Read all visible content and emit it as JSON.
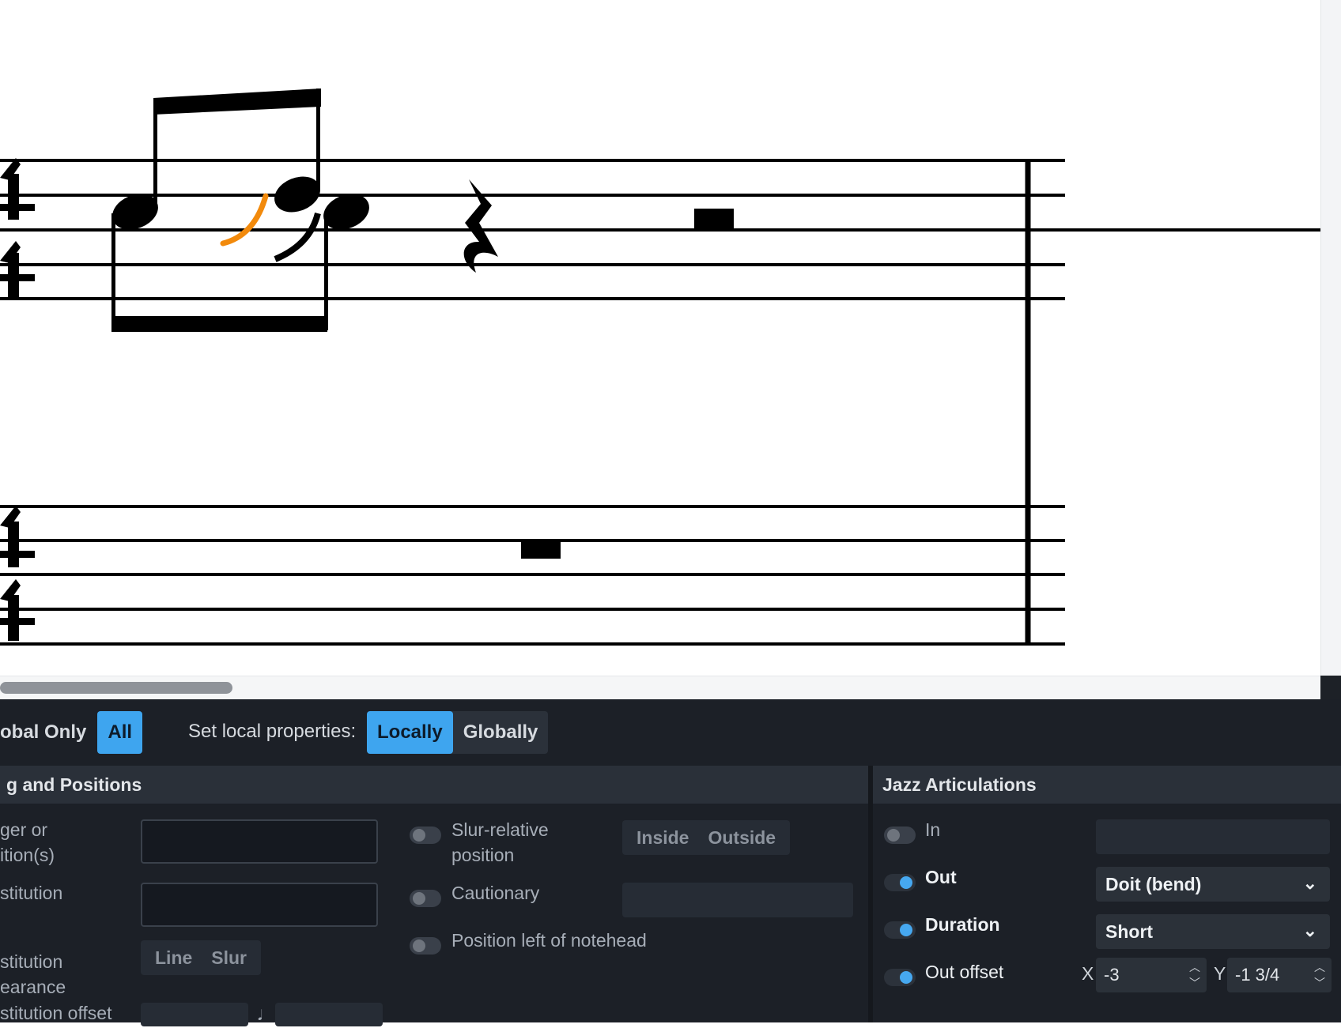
{
  "toolbar": {
    "show_options": [
      "obal Only",
      "All"
    ],
    "set_local_label": "Set local properties:",
    "set_local_options": [
      "Locally",
      "Globally"
    ]
  },
  "left_section": {
    "title": "g and Positions",
    "labels": {
      "finger_line1": "ger or",
      "finger_line2": "ition(s)",
      "substitution": "stitution",
      "appearance_line1": "stitution",
      "appearance_line2": "earance",
      "offset": "stitution offset"
    },
    "appearance_options": [
      "Line",
      "Slur"
    ],
    "slur_relative_line1": "Slur-relative",
    "slur_relative_line2": "position",
    "slur_options": [
      "Inside",
      "Outside"
    ],
    "cautionary": "Cautionary",
    "position_left": "Position left of notehead"
  },
  "right_section": {
    "title": "Jazz Articulations",
    "in_label": "In",
    "out_label": "Out",
    "out_value": "Doit (bend)",
    "duration_label": "Duration",
    "duration_value": "Short",
    "out_offset_label": "Out offset",
    "x_label": "X",
    "x_value": "-3",
    "y_label": "Y",
    "y_value": "-1 3/4"
  },
  "colors": {
    "accent": "#3ea5ef",
    "selection": "#f28a0c",
    "panel_bg": "#1c2027"
  },
  "icons": {
    "chevron": "chevron-down-icon",
    "spinner": "up-down-spinner-icon"
  }
}
